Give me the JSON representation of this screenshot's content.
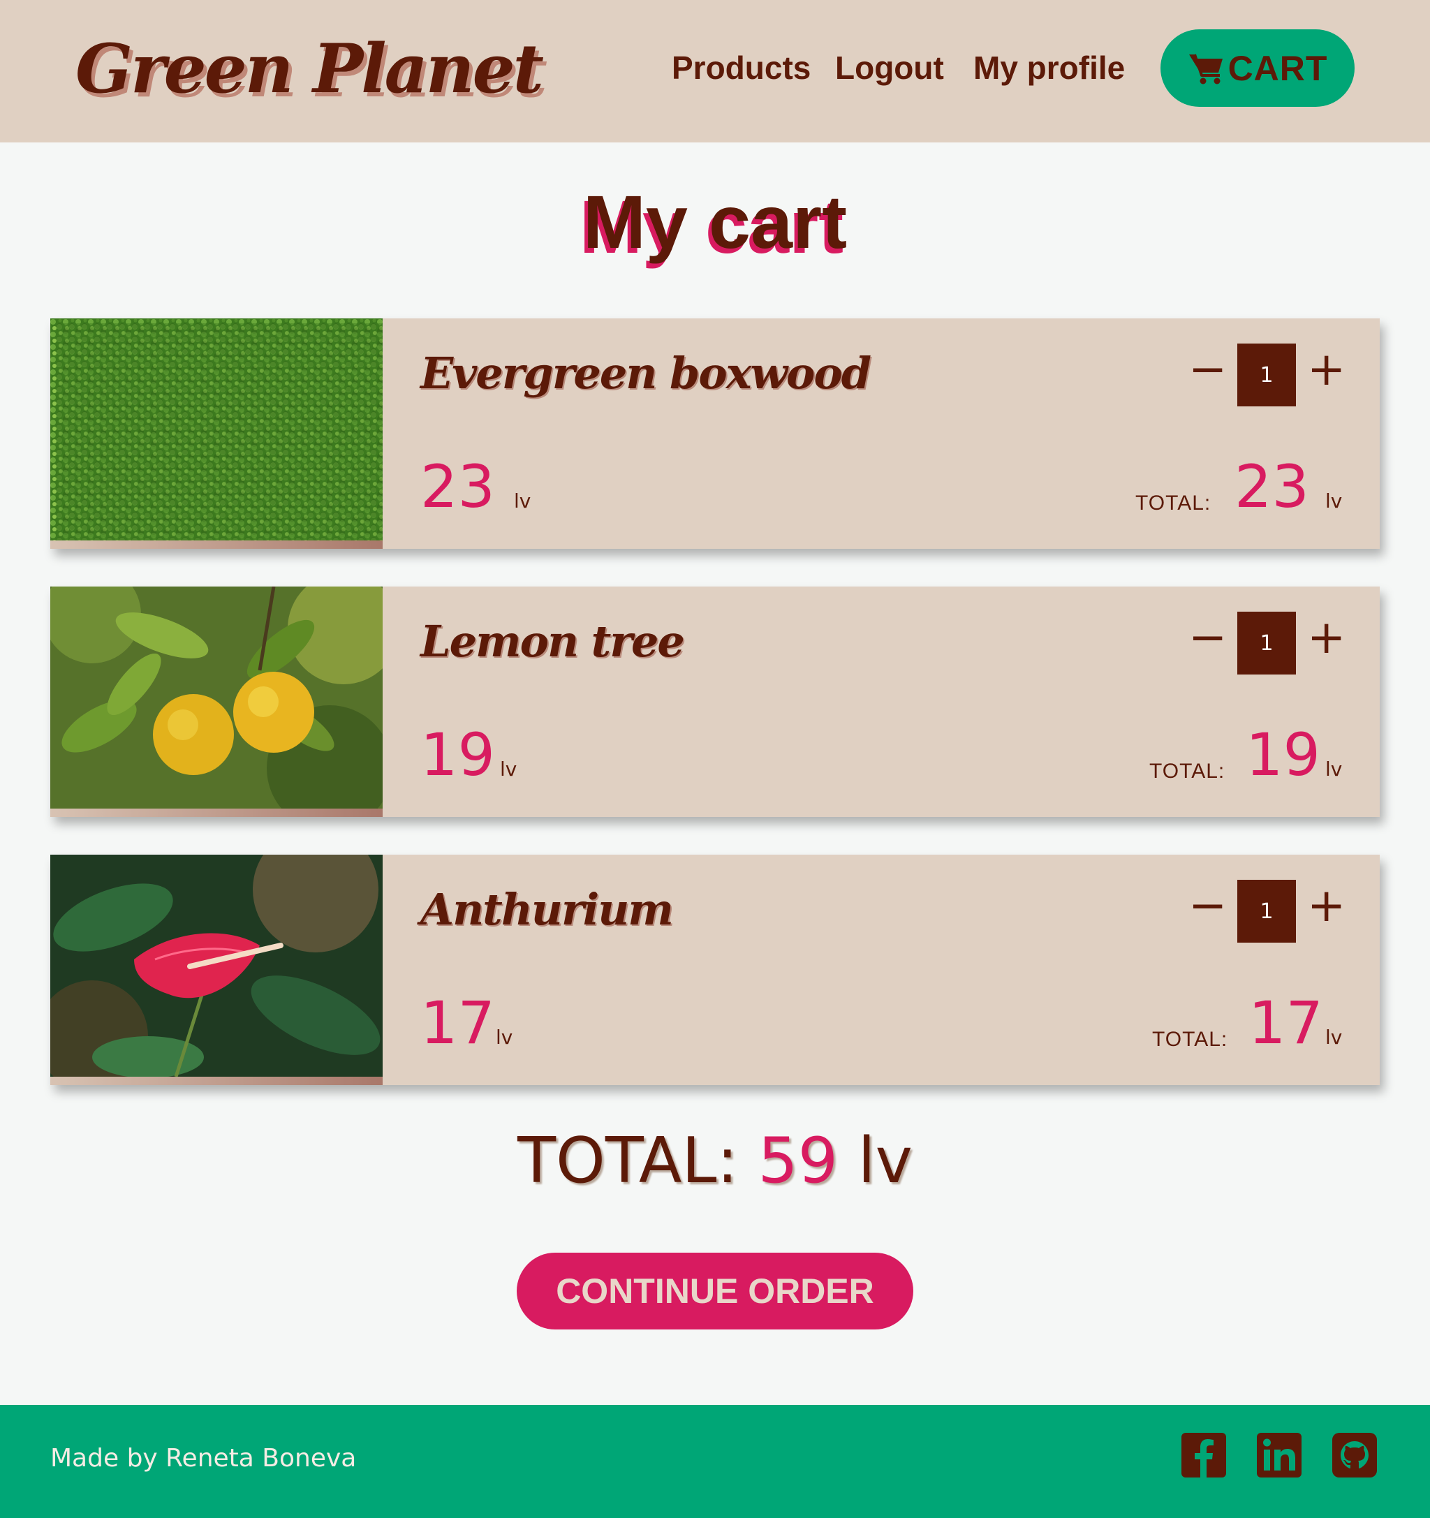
{
  "header": {
    "logo": "Green Planet",
    "nav": {
      "products": "Products",
      "logout": "Logout",
      "profile": "My profile"
    },
    "cart_label": "CART",
    "cart_icon": "cart-icon"
  },
  "page_title": "My cart",
  "items": [
    {
      "name": "Evergreen boxwood",
      "price": "23",
      "unit": "lv",
      "quantity": "1",
      "minus": "−",
      "plus": "+",
      "total_label": "TOTAL:",
      "total": "23",
      "total_unit": "lv"
    },
    {
      "name": "Lemon tree",
      "price": "19",
      "unit": "lv",
      "quantity": "1",
      "minus": "−",
      "plus": "+",
      "total_label": "TOTAL:",
      "total": "19",
      "total_unit": "lv"
    },
    {
      "name": "Anthurium",
      "price": "17",
      "unit": "lv",
      "quantity": "1",
      "minus": "−",
      "plus": "+",
      "total_label": "TOTAL:",
      "total": "17",
      "total_unit": "lv"
    }
  ],
  "summary": {
    "label": "TOTAL:",
    "amount": "59",
    "unit": "lv"
  },
  "continue_label": "CONTINUE ORDER",
  "footer": {
    "credit": "Made by Reneta Boneva",
    "icons": [
      "facebook-icon",
      "linkedin-icon",
      "github-icon"
    ]
  },
  "colors": {
    "brown": "#5c1a08",
    "beige": "#e0d0c2",
    "green": "#00a676",
    "pink": "#d81b60"
  }
}
